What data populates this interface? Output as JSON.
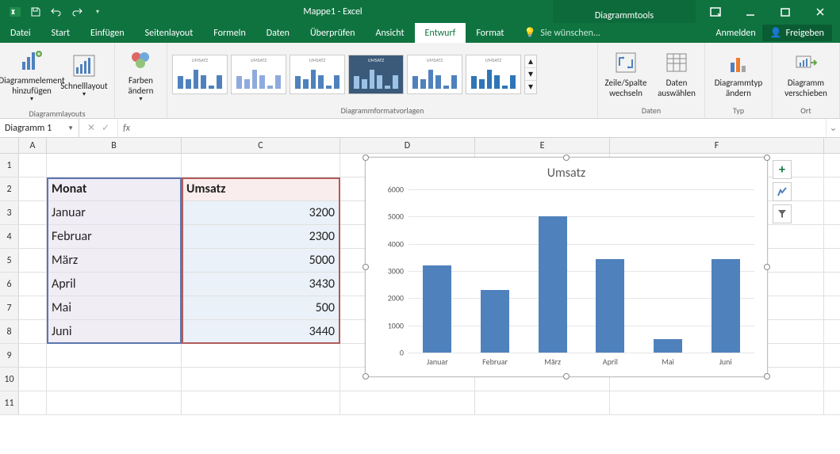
{
  "titlebar": {
    "title": "Mappe1 - Excel",
    "tools_caption": "Diagrammtools"
  },
  "tabs": {
    "file": "Datei",
    "items": [
      "Start",
      "Einfügen",
      "Seitenlayout",
      "Formeln",
      "Daten",
      "Überprüfen",
      "Ansicht",
      "Entwurf",
      "Format"
    ],
    "active": "Entwurf",
    "tell_me": "Sie wünschen...",
    "signin": "Anmelden",
    "share": "Freigeben"
  },
  "ribbon": {
    "layouts": {
      "label": "Diagrammlayouts",
      "add_element": "Diagrammelement hinzufügen",
      "quick_layout": "Schnelllayout"
    },
    "colors": {
      "label": "Farben ändern"
    },
    "styles": {
      "label": "Diagrammformatvorlagen",
      "thumb_caption": "UMSATZ"
    },
    "data": {
      "label": "Daten",
      "switch": "Zeile/Spalte wechseln",
      "select": "Daten auswählen"
    },
    "type": {
      "label": "Typ",
      "change": "Diagrammtyp ändern"
    },
    "location": {
      "label": "Ort",
      "move": "Diagramm verschieben"
    }
  },
  "namebox": "Diagramm 1",
  "formula_bar": "",
  "table": {
    "headers": {
      "month": "Monat",
      "value": "Umsatz"
    },
    "rows": [
      {
        "month": "Januar",
        "value": "3200"
      },
      {
        "month": "Februar",
        "value": "2300"
      },
      {
        "month": "März",
        "value": "5000"
      },
      {
        "month": "April",
        "value": "3430"
      },
      {
        "month": "Mai",
        "value": "500"
      },
      {
        "month": "Juni",
        "value": "3440"
      }
    ]
  },
  "columns": [
    "A",
    "B",
    "C",
    "D",
    "E",
    "F"
  ],
  "row_numbers": [
    "1",
    "2",
    "3",
    "4",
    "5",
    "6",
    "7",
    "8",
    "9",
    "10",
    "11"
  ],
  "chart_data": {
    "type": "bar",
    "title": "Umsatz",
    "categories": [
      "Januar",
      "Februar",
      "März",
      "April",
      "Mai",
      "Juni"
    ],
    "values": [
      3200,
      2300,
      5000,
      3430,
      500,
      3440
    ],
    "ylim": [
      0,
      6000
    ],
    "ystep": 1000,
    "xlabel": "",
    "ylabel": ""
  }
}
